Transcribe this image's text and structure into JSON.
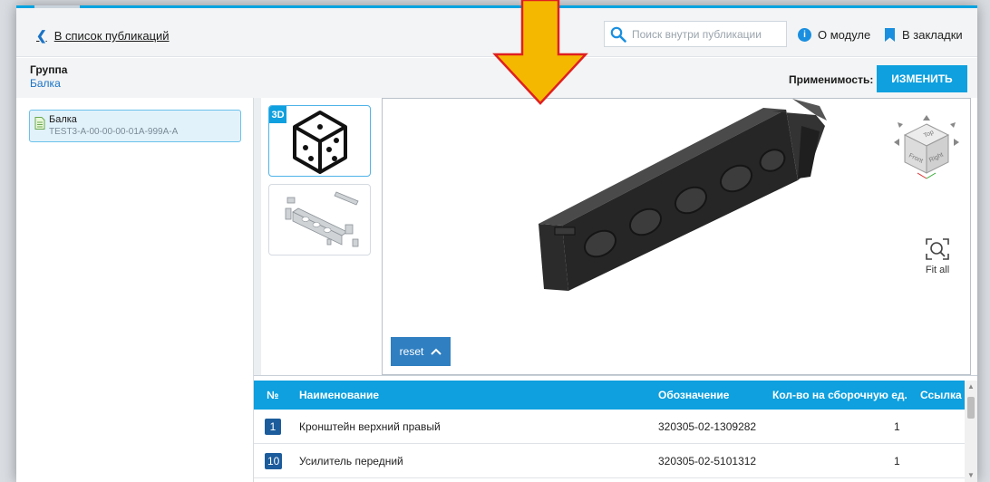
{
  "header": {
    "back_link": "В список публикаций",
    "search_placeholder": "Поиск внутри публикации",
    "about_label": "О модуле",
    "bookmarks_label": "В закладки"
  },
  "group_bar": {
    "group_label": "Группа",
    "group_value": "Балка",
    "applicability_label": "Применимость:",
    "change_button": "ИЗМЕНИТЬ"
  },
  "tree": {
    "items": [
      {
        "title": "Балка",
        "code": "TEST3-A-00-00-00-01A-999A-A"
      }
    ]
  },
  "thumbnails": {
    "badge_3d": "3D"
  },
  "viewer": {
    "reset_label": "reset",
    "fit_all_label": "Fit all",
    "cube_faces": {
      "top": "Top",
      "front": "Front",
      "right": "Right"
    }
  },
  "table": {
    "headers": {
      "number": "№",
      "name": "Наименование",
      "designation": "Обозначение",
      "qty": "Кол-во на сборочную ед.",
      "link": "Ссылка"
    },
    "rows": [
      {
        "number": "1",
        "name": "Кронштейн верхний правый",
        "designation": "320305-02-1309282",
        "qty": "1"
      },
      {
        "number": "10",
        "name": "Усилитель передний",
        "designation": "320305-02-5101312",
        "qty": "1"
      }
    ]
  },
  "colors": {
    "accent": "#0ea0df",
    "link": "#1a73c6",
    "badge_number": "#1c5c9c",
    "callout_arrow": "#f5b800",
    "callout_outline": "#e02020"
  }
}
